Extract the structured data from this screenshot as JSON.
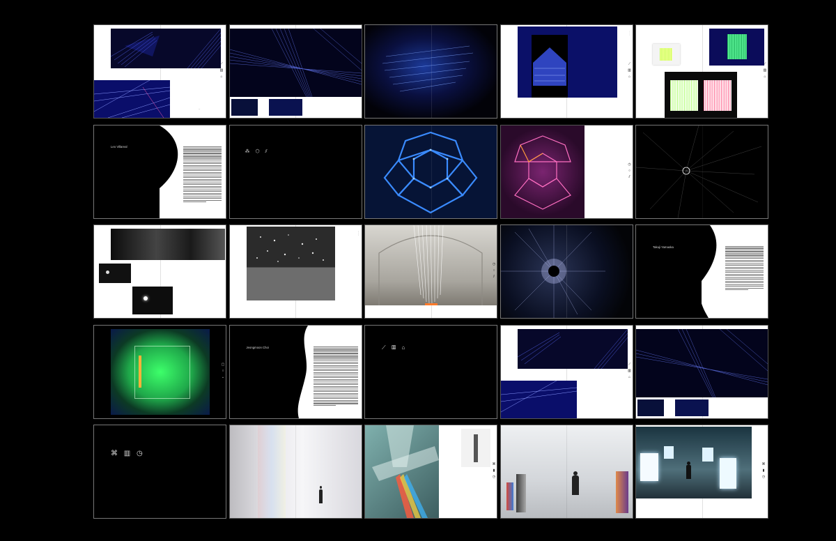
{
  "titles": {
    "artist_1": "Leo Villareal",
    "artist_2": "Takuji Yamaoka",
    "artist_3": "Jeongmoon Choi"
  },
  "colors": {
    "background": "#000000",
    "paper": "#ffffff",
    "string_blue": "#2d3cff",
    "neon_green": "#39ff6a",
    "magenta": "#b0357a"
  },
  "icon_names": [
    "string-art-icon",
    "bars-icon",
    "house-icon",
    "prism-icon",
    "circle-icon",
    "hexagon-icon",
    "starburst-icon"
  ],
  "icon_glyphs": {
    "row2_symbols": "⁂ ⬡ ⫽",
    "row4_symbols": "⟋ ▥ ⌂",
    "row5_symbols": "⌘ ▥ ◷"
  }
}
